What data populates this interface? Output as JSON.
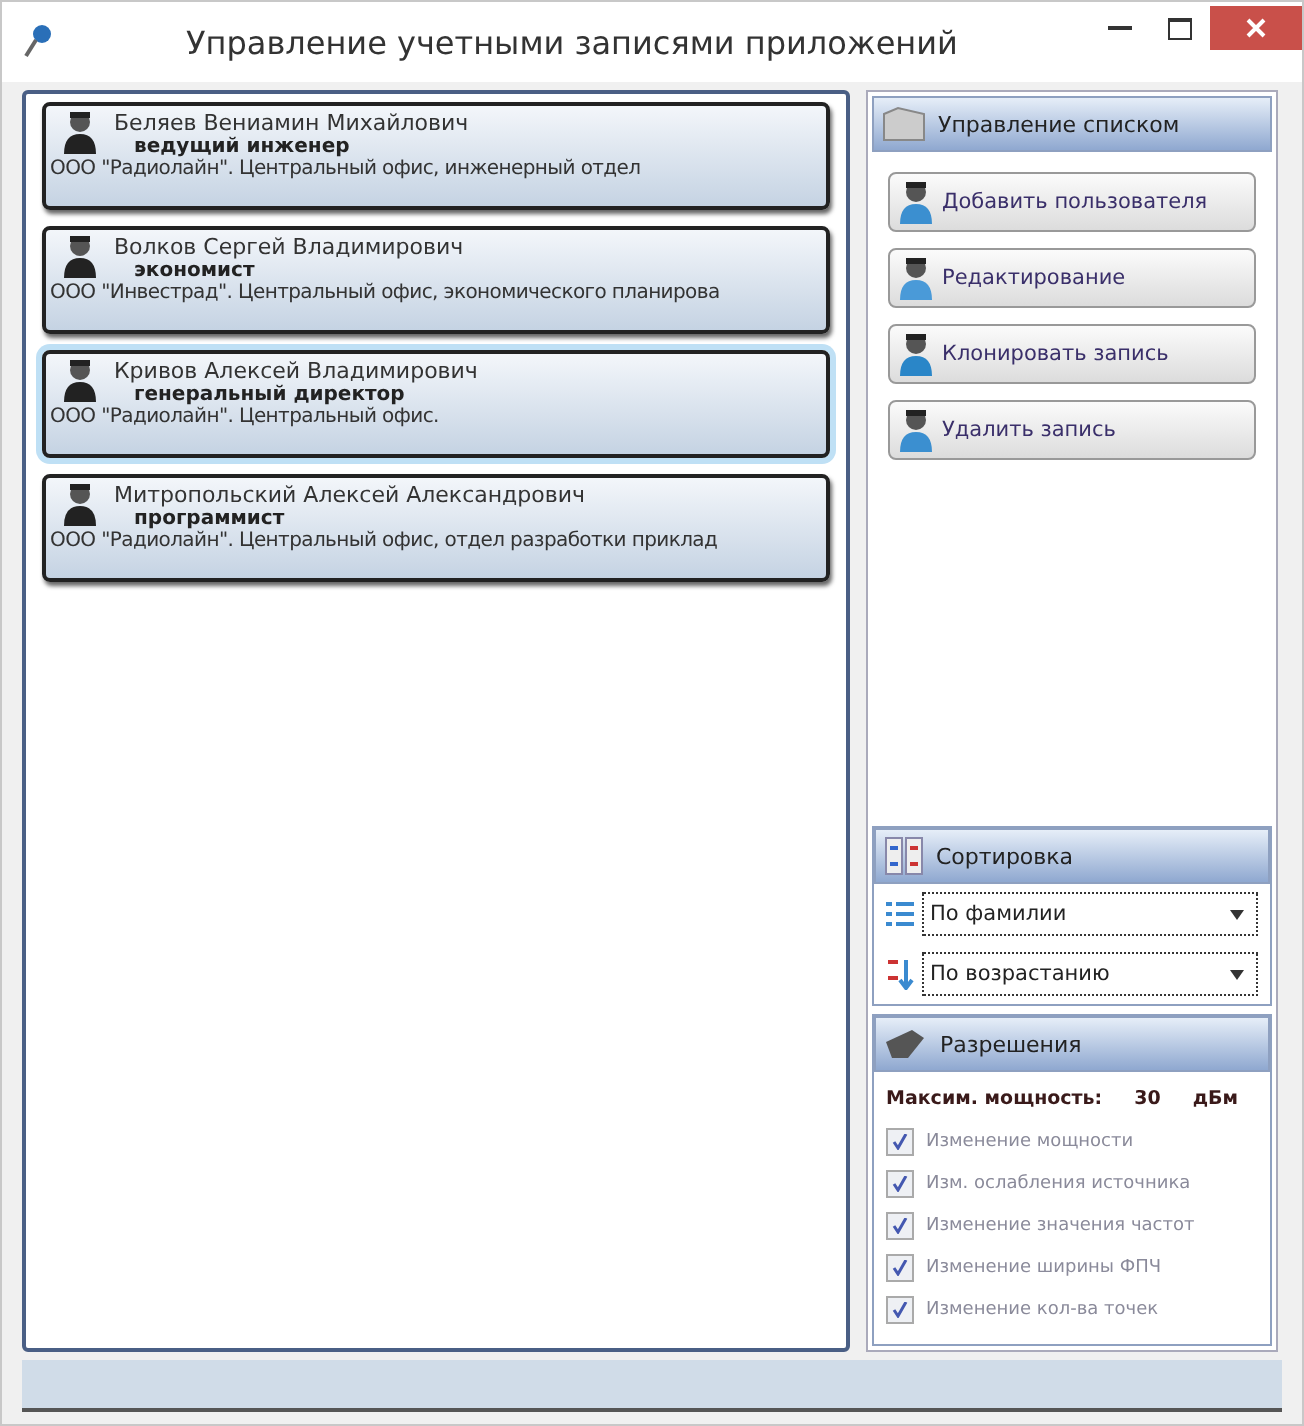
{
  "window": {
    "title": "Управление учетными записями приложений"
  },
  "users": [
    {
      "name": "Беляев Вениамин Михайлович",
      "position": "ведущий инженер",
      "org": "ООО \"Радиолайн\". Центральный офис, инженерный отдел",
      "selected": false
    },
    {
      "name": "Волков Сергей Владимирович",
      "position": "экономист",
      "org": "ООО \"Инвестрад\". Центральный офис, экономического планирова",
      "selected": false
    },
    {
      "name": "Кривов Алексей Владимирович",
      "position": "генеральный директор",
      "org": "ООО \"Радиолайн\". Центральный офис.",
      "selected": true
    },
    {
      "name": "Митропольский Алексей Александрович",
      "position": "программист",
      "org": "ООО \"Радиолайн\". Центральный офис, отдел разработки приклад",
      "selected": false
    }
  ],
  "list_panel": {
    "title": "Управление списком",
    "buttons": [
      {
        "label": "Добавить пользователя",
        "kind": "add"
      },
      {
        "label": "Редактирование",
        "kind": "edit"
      },
      {
        "label": "Клонировать запись",
        "kind": "clone"
      },
      {
        "label": "Удалить запись",
        "kind": "delete"
      }
    ]
  },
  "sort_panel": {
    "title": "Сортировка",
    "field": "По фамилии",
    "order": "По возрастанию"
  },
  "permissions": {
    "title": "Разрешения",
    "max_power_label": "Максим. мощность:",
    "max_power_value": "30",
    "max_power_unit": "дБм",
    "items": [
      {
        "label": "Изменение мощности",
        "checked": true,
        "disabled": true
      },
      {
        "label": "Изм. ослабления источника",
        "checked": true,
        "disabled": true
      },
      {
        "label": "Изменение значения частот",
        "checked": true,
        "disabled": true
      },
      {
        "label": "Изменение ширины ФПЧ",
        "checked": true,
        "disabled": true
      },
      {
        "label": "Изменение кол-ва точек",
        "checked": true,
        "disabled": true
      }
    ]
  }
}
